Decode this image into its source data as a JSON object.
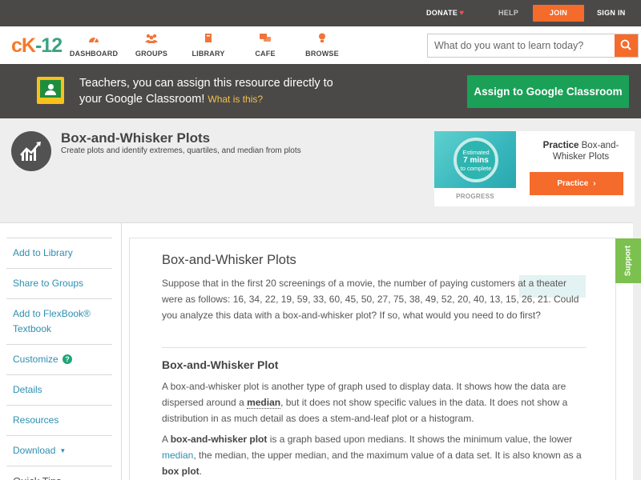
{
  "topbar": {
    "donate": "DONATE",
    "help": "HELP",
    "join": "JOIN",
    "signin": "SIGN IN",
    "icons": {
      "donate": "heart-icon"
    }
  },
  "nav": {
    "logo": {
      "left": "cK",
      "right": "-12"
    },
    "items": [
      {
        "label": "DASHBOARD",
        "icon": "dashboard-icon"
      },
      {
        "label": "GROUPS",
        "icon": "groups-icon"
      },
      {
        "label": "LIBRARY",
        "icon": "library-icon"
      },
      {
        "label": "CAFE",
        "icon": "cafe-icon"
      },
      {
        "label": "BROWSE",
        "icon": "browse-icon"
      }
    ],
    "search_placeholder": "What do you want to learn today?"
  },
  "banner": {
    "text": "Teachers, you can assign this resource directly to your Google Classroom!",
    "what_link": "What is this?",
    "button": "Assign to Google Classroom"
  },
  "concept": {
    "title": "Box-and-Whisker Plots",
    "description": "Create plots and identify extremes, quartiles, and median from plots"
  },
  "practice_card": {
    "estimated": "Estimated",
    "mins": "7 mins",
    "to_complete": "to complete",
    "progress": "PROGRESS",
    "title_bold": "Practice",
    "title_rest": "Box-and-Whisker Plots",
    "button": "Practice"
  },
  "sidebar": {
    "items": [
      {
        "label": "Add to Library"
      },
      {
        "label": "Share to Groups"
      },
      {
        "label": "Add to FlexBook® Textbook"
      },
      {
        "label": "Customize"
      },
      {
        "label": "Details"
      },
      {
        "label": "Resources"
      },
      {
        "label": "Download"
      },
      {
        "label": "Quick Tips"
      }
    ]
  },
  "article": {
    "title": "Box-and-Whisker Plots",
    "intro": "Suppose that in the first 20 screenings of a movie, the number of paying customers at a theater were as follows: 16, 34, 22, 19, 59, 33, 60, 45, 50, 27, 75, 38, 49, 52, 20, 40, 13, 15, 26, 21. Could you analyze this data with a box-and-whisker plot? If so, what would you need to do first?",
    "section_heading": "Box-and-Whisker Plot",
    "p2_a": "A box-and-whisker plot is another type of graph used to display data. It shows how the data are dispersed around a ",
    "p2_median": "median",
    "p2_b": ", but it does not show specific values in the data. It does not show a distribution in as much detail as does a stem-and-leaf plot or a histogram.",
    "p3_a": "A ",
    "p3_bold": "box-and-whisker plot",
    "p3_b": " is a graph based upon medians. It shows the minimum value, the lower ",
    "p3_link": "median",
    "p3_c": ", the median, the upper median, and the maximum value of a data set. It is also known as a ",
    "p3_bold2": "box plot",
    "p3_d": "."
  },
  "support": "Support",
  "colors": {
    "accent_orange": "#f46b2b",
    "google_green": "#1aa057",
    "link_blue": "#2e8fb0",
    "dark_bar": "#4b4948",
    "support_green": "#7cc14f"
  }
}
